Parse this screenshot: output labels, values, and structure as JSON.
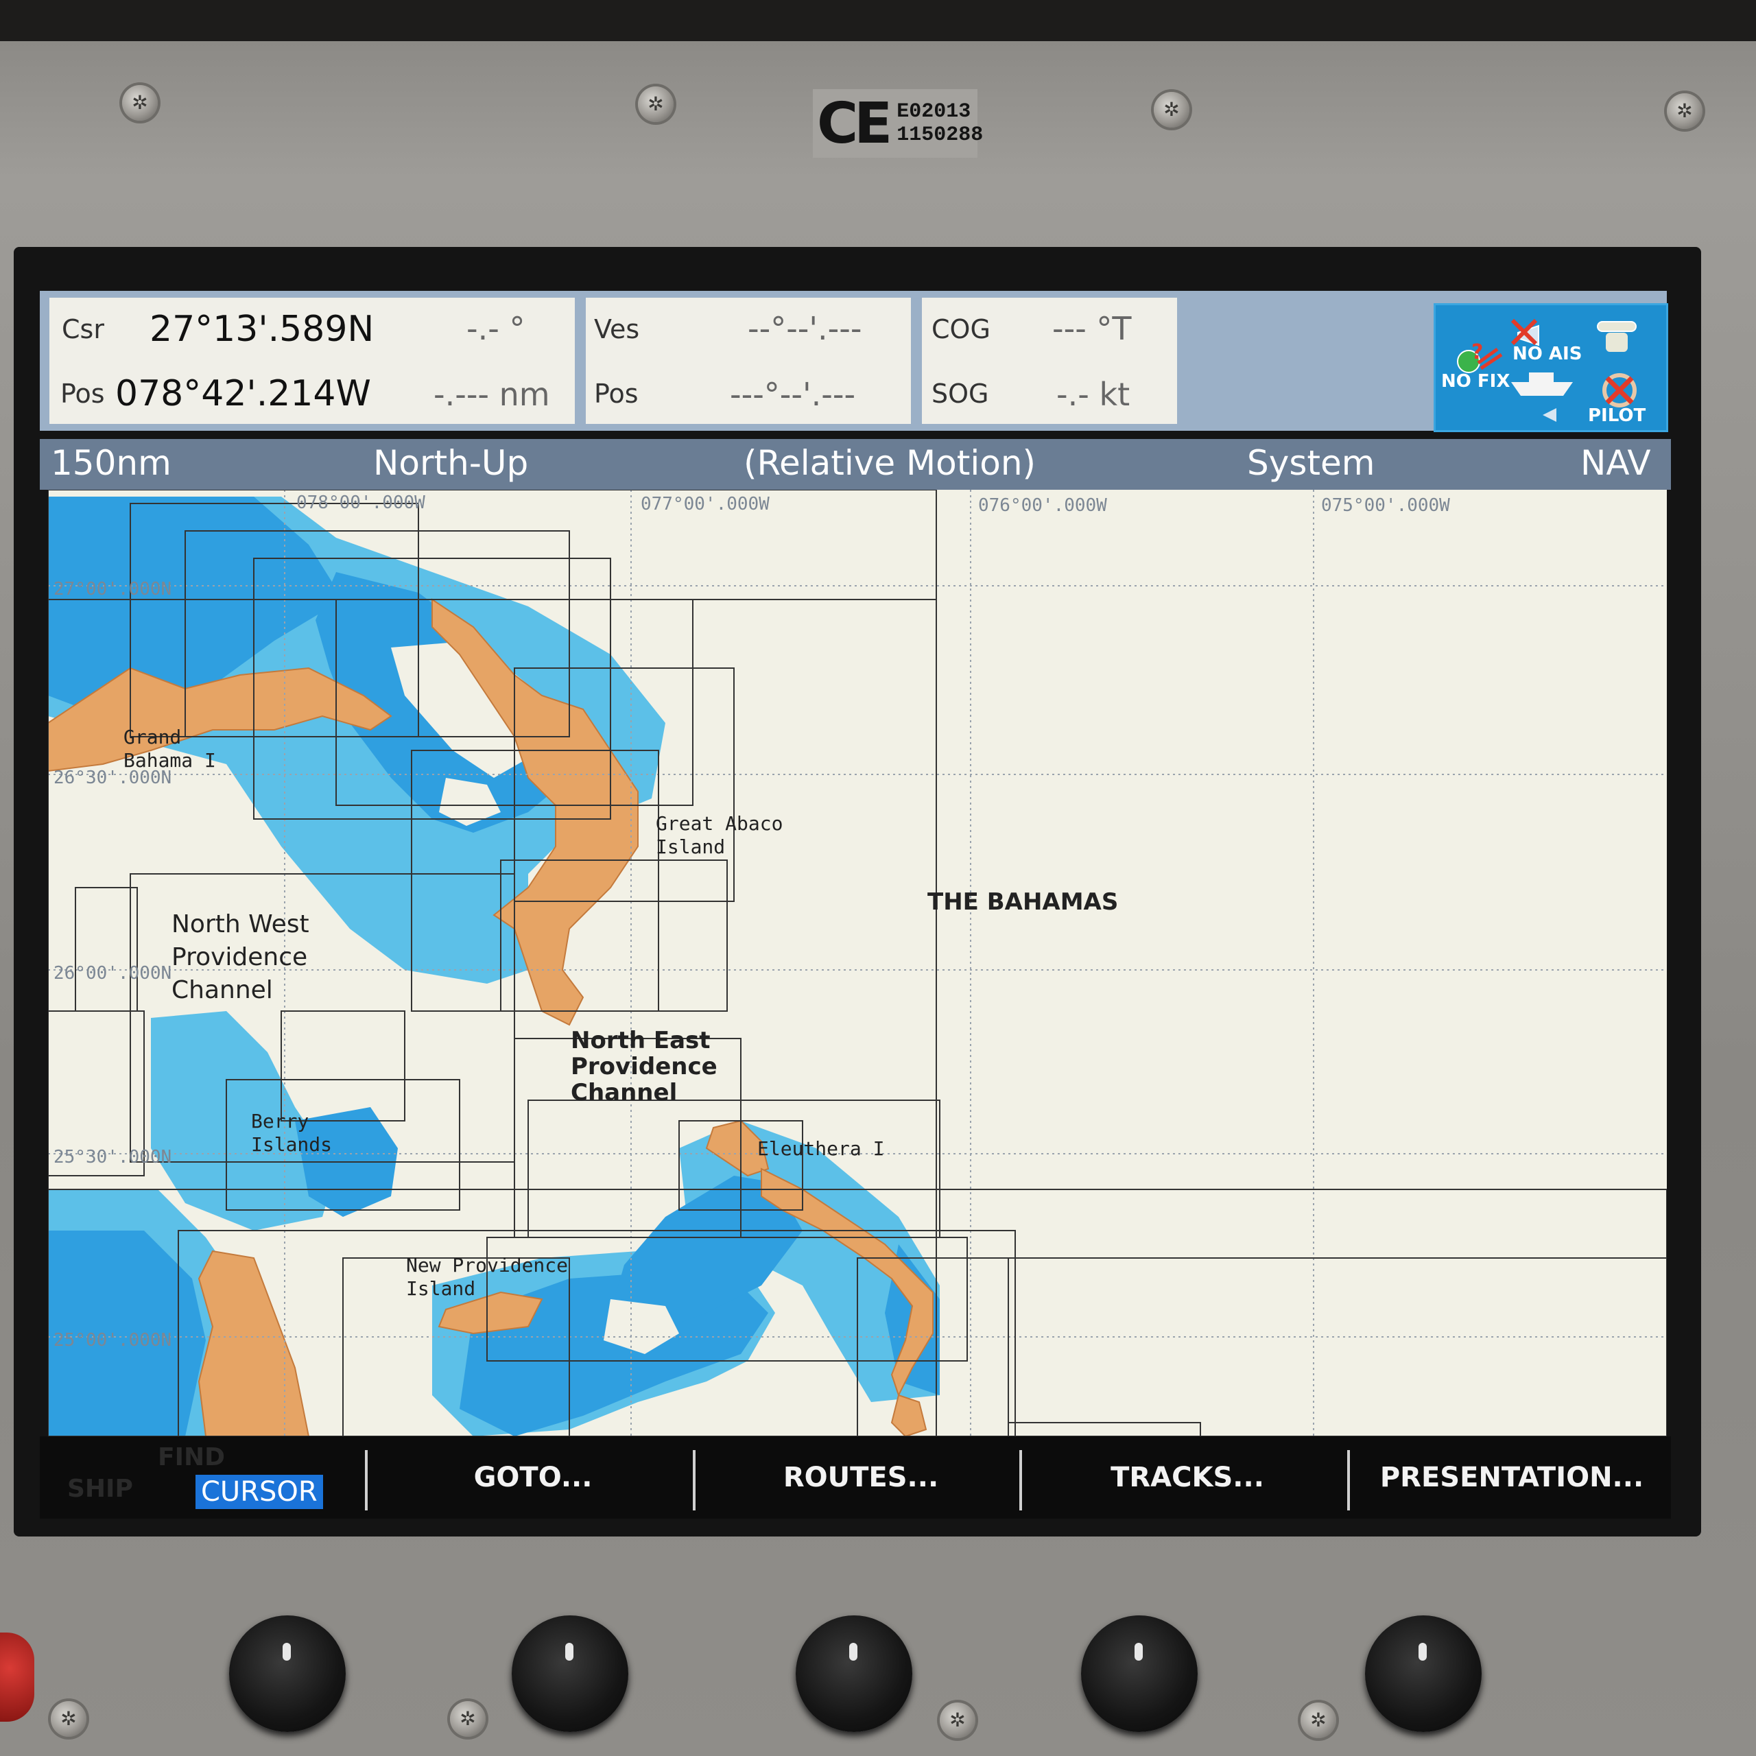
{
  "device": {
    "ce_mark": "CE",
    "approval_code_1": "E02013",
    "approval_code_2": "1150288"
  },
  "header": {
    "cursor": {
      "label_1": "Csr",
      "label_2": "Pos",
      "latitude": "27°13'.589N",
      "longitude": "078°42'.214W",
      "bearing": "-.- °",
      "range": "-.--- nm"
    },
    "vessel": {
      "label_1": "Ves",
      "label_2": "Pos",
      "latitude": "--°--'.---",
      "longitude": "---°--'.---"
    },
    "course": {
      "cog_label": "COG",
      "cog_value": "--- °T",
      "sog_label": "SOG",
      "sog_value": "-.- kt"
    },
    "status_icons": {
      "no_fix": "NO FIX",
      "no_ais": "NO AIS",
      "pilot": "PILOT",
      "icons": [
        "gps-no-fix-icon",
        "ais-off-icon",
        "radar-antenna-icon",
        "vessel-icon",
        "autopilot-off-icon"
      ]
    }
  },
  "titlebar": {
    "range": "150nm",
    "orientation": "North-Up",
    "motion": "(Relative Motion)",
    "mode": "System",
    "page": "NAV"
  },
  "chart": {
    "longitudes": [
      "078°00'.000W",
      "077°00'.000W",
      "076°00'.000W",
      "075°00'.000W"
    ],
    "latitudes": [
      "27°00'.000N",
      "26°30'.000N",
      "26°00'.000N",
      "25°30'.000N",
      "25°00'.000N"
    ],
    "places": {
      "grand_bahama": "Grand\nBahama I",
      "great_abaco": "Great Abaco\nIsland",
      "bahamas": "THE BAHAMAS",
      "nw_channel": "North West\nProvidence\nChannel",
      "ne_channel": "North East\nProvidence\nChannel",
      "berry": "Berry\nIslands",
      "eleuthera": "Eleuthera I",
      "new_providence": "New Providence\nIsland"
    },
    "colors": {
      "land": "#e6a465",
      "shallow": "#2f9fe0",
      "medium": "#5cc0e8",
      "deep": "#f2f1e6",
      "grid": "#9aa3ad",
      "chart_border": "#222222"
    }
  },
  "softkeys": {
    "ghost_1": "FIND",
    "ghost_2": "SHIP",
    "cursor": "CURSOR",
    "goto": "GOTO...",
    "routes": "ROUTES...",
    "tracks": "TRACKS...",
    "presentation": "PRESENTATION..."
  }
}
